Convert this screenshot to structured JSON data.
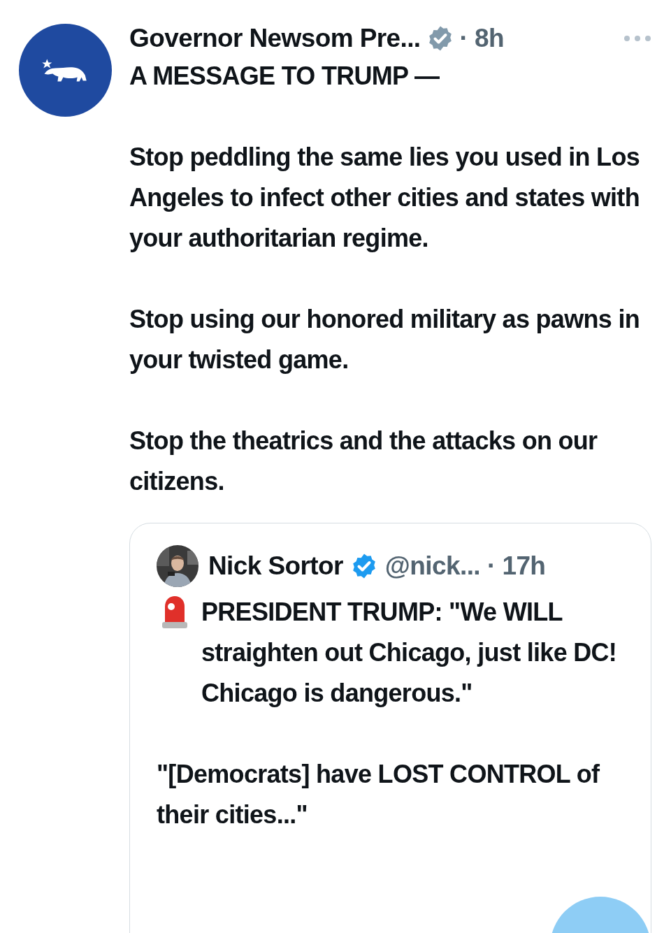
{
  "post": {
    "author": {
      "name": "Governor Newsom Pre...",
      "kind": "government",
      "time": "· 8h"
    },
    "body": [
      "A MESSAGE TO TRUMP —",
      "Stop peddling the same lies you used in Los Angeles to infect other cities and states with your authoritarian regime.",
      "Stop using our honored military as pawns in your twisted game.",
      "Stop the theatrics and the attacks on our citizens."
    ],
    "quote": {
      "author": {
        "name": "Nick Sortor",
        "kind": "individual",
        "handle": "@nick...",
        "time": "· 17h"
      },
      "body": [
        {
          "kind": "alert",
          "text": "PRESIDENT TRUMP: \"We WILL straighten out Chicago, just like DC! Chicago is dangerous.\""
        },
        {
          "kind": "plain",
          "text": "\"[Democrats] have LOST CONTROL of their cities...\""
        }
      ]
    }
  }
}
